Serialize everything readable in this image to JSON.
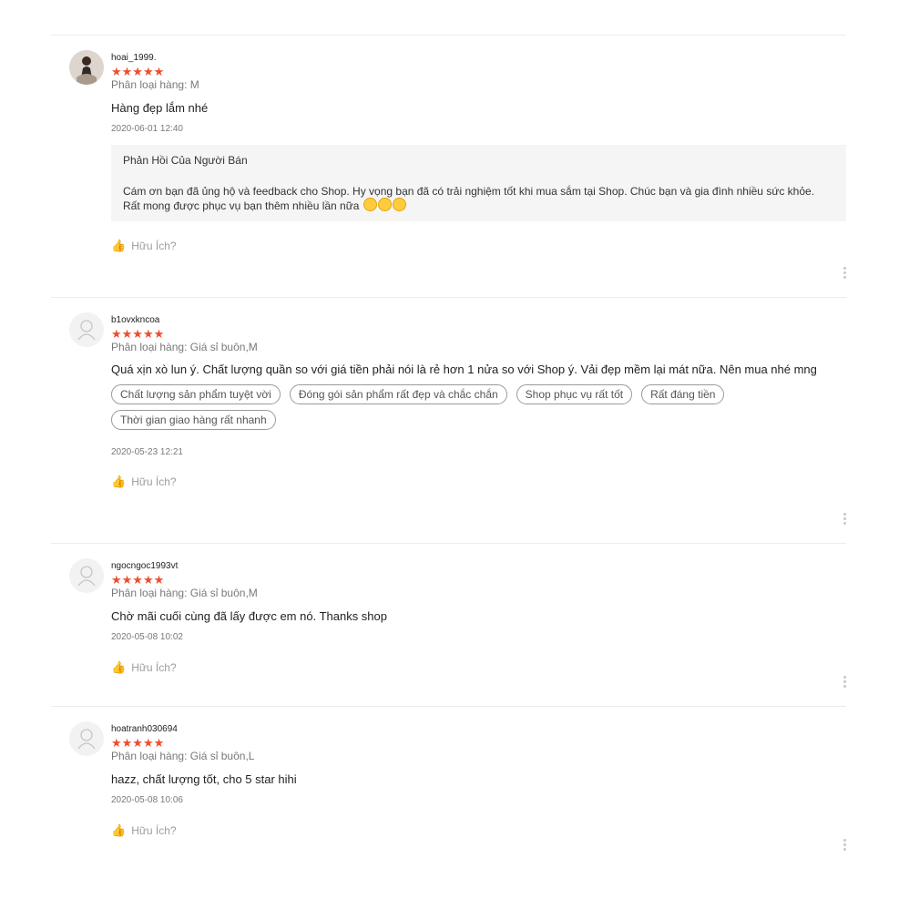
{
  "reviews": [
    {
      "username": "hoai_1999.",
      "stars": "★★★★★",
      "variation": "Phân loại hàng: M",
      "comment": "Hàng đẹp lắm nhé",
      "time": "2020-06-01 12:40",
      "reply": {
        "title": "Phản Hồi Của Người Bán",
        "text": "Cám ơn bạn đã ủng hộ và feedback cho Shop. Hy vọng bạn đã có trải nghiệm tốt khi mua sắm tại Shop. Chúc bạn và gia đình nhiều sức khỏe. Rất mong được phục vụ bạn thêm nhiều lần nữa"
      },
      "helpful": "Hữu Ích?"
    },
    {
      "username": "b1ovxkncoa",
      "stars": "★★★★★",
      "variation": "Phân loại hàng: Giá sỉ buôn,M",
      "comment": "Quá xịn xò lun ý. Chất lượng quần so với giá tiền phải nói là rẻ hơn 1 nửa so với Shop ý. Vải đẹp mềm lại mát nữa. Nên mua nhé mng",
      "tags": [
        "Chất lượng sản phẩm tuyệt vời",
        "Đóng gói sản phẩm rất đẹp và chắc chắn",
        "Shop phục vụ rất tốt",
        "Rất đáng tiền",
        "Thời gian giao hàng rất nhanh"
      ],
      "time": "2020-05-23 12:21",
      "helpful": "Hữu Ích?"
    },
    {
      "username": "ngocngoc1993vt",
      "stars": "★★★★★",
      "variation": "Phân loại hàng: Giá sỉ buôn,M",
      "comment": "Chờ mãi cuối cùng đã lấy được em nó. Thanks shop",
      "time": "2020-05-08 10:02",
      "helpful": "Hữu Ích?"
    },
    {
      "username": "hoatranh030694",
      "stars": "★★★★★",
      "variation": "Phân loại hàng: Giá sỉ buôn,L",
      "comment": "hazz, chất lượng tốt, cho 5 star hihi",
      "time": "2020-05-08 10:06",
      "helpful": "Hữu Ích?"
    }
  ],
  "colors": {
    "star": "#ee4d2d",
    "reply_bg": "#f5f5f5",
    "divider": "#ececec"
  },
  "icons": [
    "default-avatar-icon",
    "thumbs-up-icon",
    "more-vertical-icon",
    "kissing-emoji-icon"
  ]
}
